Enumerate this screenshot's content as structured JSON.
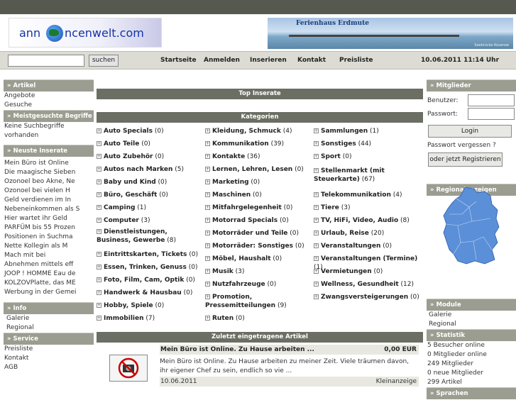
{
  "logo": {
    "text_left": "ann",
    "text_right": "ncenwelt.com"
  },
  "banner": {
    "title": "Ferienhaus Erdmute",
    "subtitle": "Seebrücke Koserow"
  },
  "search": {
    "placeholder": "",
    "button": "suchen"
  },
  "nav": [
    "Startseite",
    "Anmelden",
    "Inserieren",
    "Kontakt",
    "Preisliste"
  ],
  "datetime": "10.06.2011 11:14 Uhr",
  "left": {
    "artikel_head": "Artikel",
    "artikel_items": [
      "Angebote",
      "Gesuche"
    ],
    "meist_head": "Meistgesuchte Begriffe",
    "meist_text": [
      "Keine Suchbegriffe",
      "vorhanden"
    ],
    "neuste_head": "Neuste Inserate",
    "neuste_items": [
      "Mein Büro ist Online",
      "Die maagische Sieben",
      "Ozonoel beo Akne, Ne",
      "Ozonoel bei vielen H",
      "Geld verdienen im In",
      "Nebeneinkommen als S",
      "Hier wartet ihr Geld",
      "PARFÜM bis 55 Prozen",
      "Positionen in Suchma",
      "Nette Kollegin als M",
      "Mach mit bei",
      "Abnehmen mittels eff",
      "JOOP ! HOMME Eau de",
      "KOLZOVPlatte, das ME",
      "Werbung in der Gemei"
    ],
    "info_head": "Info",
    "info_items": [
      "Galerie",
      "Regional"
    ],
    "service_head": "Service",
    "service_items": [
      "Preisliste",
      "Kontakt",
      "AGB"
    ]
  },
  "main": {
    "top_label": "Top Inserate",
    "kat_label": "Kategorien",
    "col1": [
      {
        "name": "Auto Specials",
        "count": "(0)"
      },
      {
        "name": "Auto Teile",
        "count": "(0)"
      },
      {
        "name": "Auto Zubehör",
        "count": "(0)"
      },
      {
        "name": "Autos nach Marken",
        "count": "(5)"
      },
      {
        "name": "Baby und Kind",
        "count": "(0)"
      },
      {
        "name": "Büro, Geschäft",
        "count": "(0)"
      },
      {
        "name": "Camping",
        "count": "(1)"
      },
      {
        "name": "Computer",
        "count": "(3)"
      },
      {
        "name": "Dienstleistungen, Business, Gewerbe",
        "count": "(8)"
      },
      {
        "name": "Eintrittskarten, Tickets",
        "count": "(0)"
      },
      {
        "name": "Essen, Trinken, Genuss",
        "count": "(0)"
      },
      {
        "name": "Foto, Film, Cam, Optik",
        "count": "(0)"
      },
      {
        "name": "Handwerk & Hausbau",
        "count": "(0)"
      },
      {
        "name": "Hobby, Spiele",
        "count": "(0)"
      },
      {
        "name": "Immobilien",
        "count": "(7)"
      }
    ],
    "col2": [
      {
        "name": "Kleidung, Schmuck",
        "count": "(4)"
      },
      {
        "name": "Kommunikation",
        "count": "(39)"
      },
      {
        "name": "Kontakte",
        "count": "(36)"
      },
      {
        "name": "Lernen, Lehren, Lesen",
        "count": "(0)"
      },
      {
        "name": "Marketing",
        "count": "(0)"
      },
      {
        "name": "Maschinen",
        "count": "(0)"
      },
      {
        "name": "Mitfahrgelegenheit",
        "count": "(0)"
      },
      {
        "name": "Motorrad Specials",
        "count": "(0)"
      },
      {
        "name": "Motorräder und Teile",
        "count": "(0)"
      },
      {
        "name": "Motorräder: Sonstiges",
        "count": "(0)"
      },
      {
        "name": "Möbel, Haushalt",
        "count": "(0)"
      },
      {
        "name": "Musik",
        "count": "(3)"
      },
      {
        "name": "Nutzfahrzeuge",
        "count": "(0)"
      },
      {
        "name": "Promotion, Pressemitteilungen",
        "count": "(9)"
      },
      {
        "name": "Ruten",
        "count": "(0)"
      }
    ],
    "col3": [
      {
        "name": "Sammlungen",
        "count": "(1)"
      },
      {
        "name": "Sonstiges",
        "count": "(44)"
      },
      {
        "name": "Sport",
        "count": "(0)"
      },
      {
        "name": "Stellenmarkt (mit Steuerkarte)",
        "count": "(67)"
      },
      {
        "name": "Telekommunikation",
        "count": "(4)"
      },
      {
        "name": "Tiere",
        "count": "(3)"
      },
      {
        "name": "TV, HiFi, Video, Audio",
        "count": "(8)"
      },
      {
        "name": "Urlaub, Reise",
        "count": "(20)"
      },
      {
        "name": "Veranstaltungen",
        "count": "(0)"
      },
      {
        "name": "Veranstaltungen (Termine)",
        "count": "(1)"
      },
      {
        "name": "Vermietungen",
        "count": "(0)"
      },
      {
        "name": "Wellness, Gesundheit",
        "count": "(12)"
      },
      {
        "name": "Zwangsversteigerungen",
        "count": "(0)"
      }
    ],
    "latest_label": "Zuletzt eingetragene Artikel",
    "article": {
      "title": "Mein Büro ist Online. Zu Hause arbeiten ...",
      "price": "0,00 EUR",
      "text": "Mein Büro ist Online. Zu Hause arbeiten zu meiner Zeit. Viele träumen davon, ihr eigener Chef zu sein, endlich so vie ...",
      "date": "10.06.2011",
      "category": "Kleinanzeige"
    }
  },
  "right": {
    "mitglieder_head": "Mitglieder",
    "benutzer_label": "Benutzer:",
    "passwort_label": "Passwort:",
    "login_button": "Login",
    "forgot": "Passwort vergessen ?",
    "register_button": "oder jetzt Registrieren",
    "regional_head": "Regionalanzeigen",
    "module_head": "Module",
    "module_items": [
      "Galerie",
      "Regional"
    ],
    "statistik_head": "Statistik",
    "statistik_items": [
      "5 Besucher online",
      "0 Mitglieder online",
      "249 Mitglieder",
      "0 neue Mitglieder",
      "299 Artikel"
    ],
    "sprachen_head": "Sprachen"
  }
}
